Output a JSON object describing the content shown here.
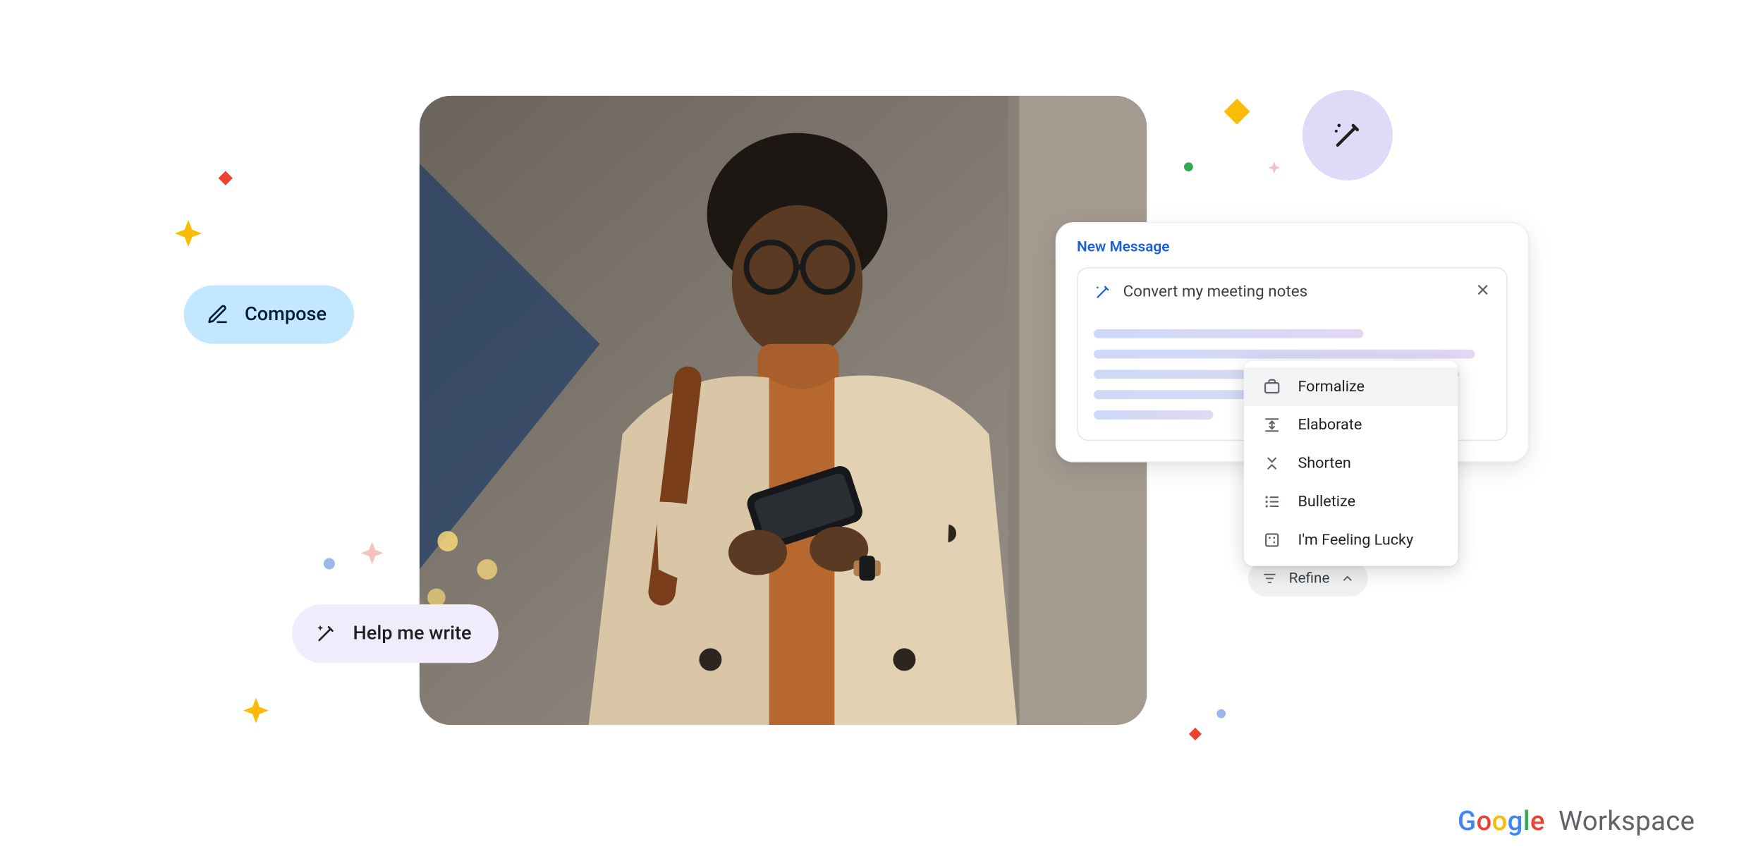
{
  "compose": {
    "label": "Compose"
  },
  "help_write": {
    "label": "Help me write"
  },
  "panel": {
    "title": "New Message",
    "prompt": "Convert my meeting notes"
  },
  "menu": {
    "items": [
      {
        "label": "Formalize"
      },
      {
        "label": "Elaborate"
      },
      {
        "label": "Shorten"
      },
      {
        "label": "Bulletize"
      },
      {
        "label": "I'm Feeling Lucky"
      }
    ]
  },
  "refine": {
    "label": "Refine"
  },
  "branding": {
    "workspace": "Workspace"
  }
}
